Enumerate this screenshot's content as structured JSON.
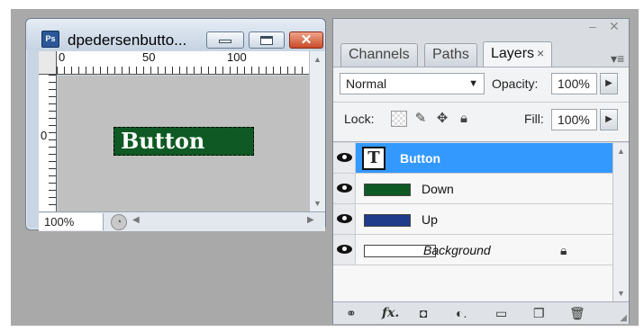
{
  "document": {
    "title": "dpedersenbutto...",
    "app_icon_label": "Ps",
    "ruler_labels": [
      "0",
      "50",
      "100"
    ],
    "ruler_left_labels": [
      "0"
    ],
    "canvas_text": "Button",
    "zoom": "100%"
  },
  "panel": {
    "tabs": [
      {
        "label": "Channels",
        "active": false
      },
      {
        "label": "Paths",
        "active": false
      },
      {
        "label": "Layers",
        "active": true
      }
    ],
    "tab_close": "×",
    "blend_mode": "Normal",
    "opacity_label": "Opacity:",
    "opacity_value": "100%",
    "lock_label": "Lock:",
    "fill_label": "Fill:",
    "fill_value": "100%",
    "layers": [
      {
        "name": "Button",
        "type": "text",
        "selected": true,
        "thumb_text": "T"
      },
      {
        "name": "Down",
        "type": "fill",
        "color": "#0f5a24",
        "selected": false
      },
      {
        "name": "Up",
        "type": "fill",
        "color": "#1f3c8a",
        "selected": false
      },
      {
        "name": "Background",
        "type": "background",
        "color": "#ffffff",
        "locked": true,
        "selected": false
      }
    ]
  },
  "colors": {
    "selection": "#3399ff",
    "canvas_button": "#0f5a24"
  }
}
